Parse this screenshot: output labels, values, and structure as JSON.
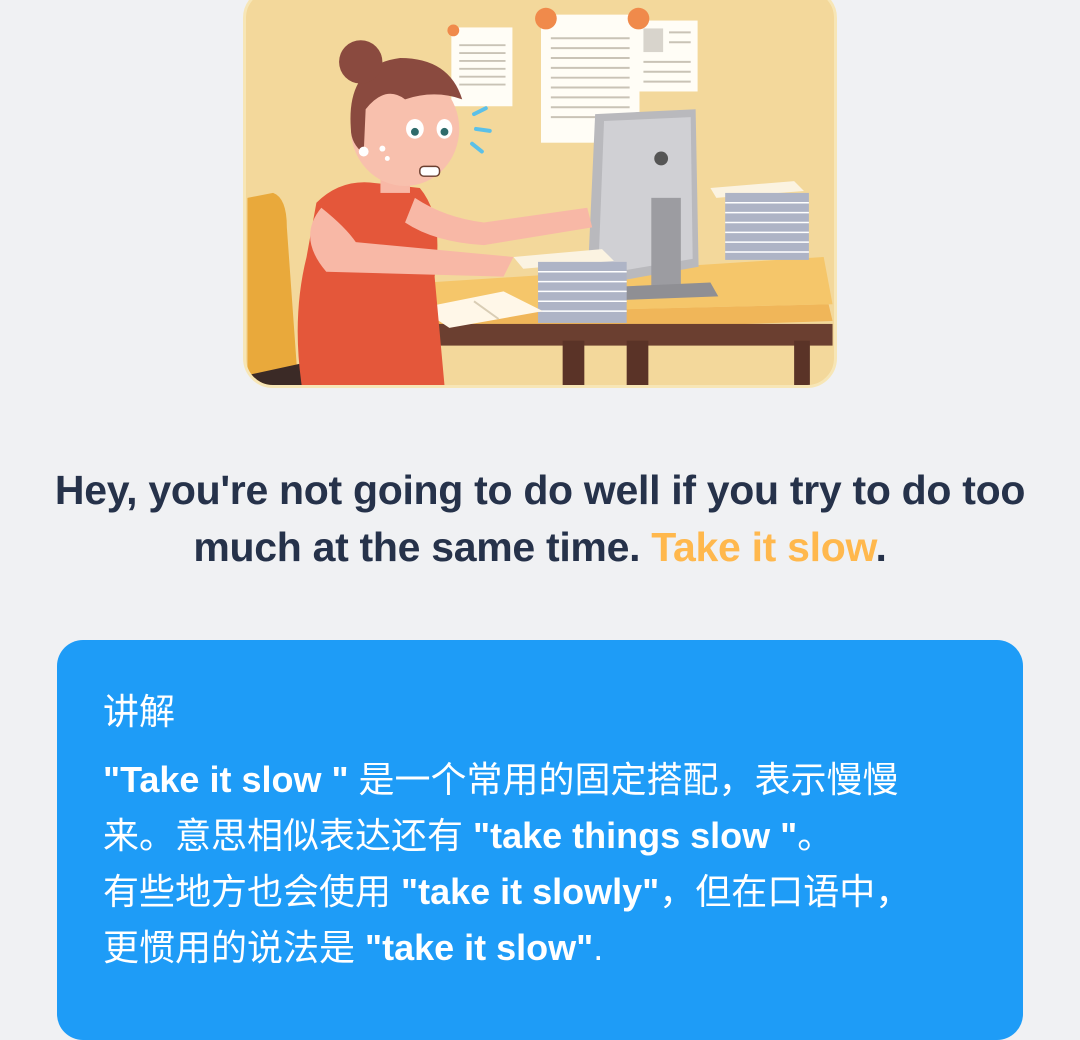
{
  "illustration": {
    "subject": "woman-stressed-at-desk-illustration"
  },
  "sentence": {
    "line1": "Hey, you're not going to do well if you try to do too",
    "line2_prefix": "much at the same time. ",
    "highlight": "Take it slow",
    "suffix": "."
  },
  "explanation": {
    "heading": "讲解",
    "l1_a": "\"Take it slow \"",
    "l1_b": " 是一个常用的固定搭配，表示慢慢",
    "l2_a": "来。意思相似表达还有 ",
    "l2_b": "\"take things slow \"",
    "l2_c": "。",
    "l3_a": "有些地方也会使用 ",
    "l3_b": "\"take it slowly\"",
    "l3_c": "，但在口语中，",
    "l4_a": "更惯用的说法是 ",
    "l4_b": "\"take it slow\"",
    "l4_c": "."
  },
  "colors": {
    "background": "#f0f1f3",
    "text": "#26324a",
    "highlight": "#ffb84d",
    "card": "#1e9cf7"
  }
}
